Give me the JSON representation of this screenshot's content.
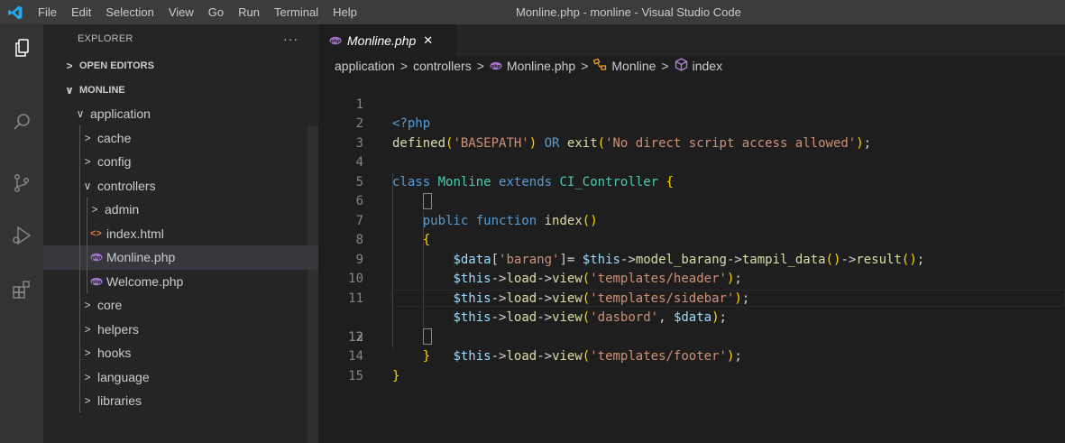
{
  "menubar": {
    "items": [
      "File",
      "Edit",
      "Selection",
      "View",
      "Go",
      "Run",
      "Terminal",
      "Help"
    ],
    "window_title": "Monline.php - monline - Visual Studio Code"
  },
  "activitybar": {
    "icons": [
      "explorer-icon",
      "search-icon",
      "source-control-icon",
      "run-debug-icon",
      "extensions-icon"
    ]
  },
  "sidebar": {
    "title": "EXPLORER",
    "more": "···",
    "open_editors": "OPEN EDITORS",
    "project": "MONLINE",
    "tree": [
      {
        "label": "application",
        "type": "folder",
        "open": true
      },
      {
        "label": "cache",
        "type": "folder",
        "open": false
      },
      {
        "label": "config",
        "type": "folder",
        "open": false
      },
      {
        "label": "controllers",
        "type": "folder",
        "open": true
      },
      {
        "label": "admin",
        "type": "folder",
        "open": false
      },
      {
        "label": "index.html",
        "type": "html"
      },
      {
        "label": "Monline.php",
        "type": "php",
        "selected": true
      },
      {
        "label": "Welcome.php",
        "type": "php"
      },
      {
        "label": "core",
        "type": "folder",
        "open": false
      },
      {
        "label": "helpers",
        "type": "folder",
        "open": false
      },
      {
        "label": "hooks",
        "type": "folder",
        "open": false
      },
      {
        "label": "language",
        "type": "folder",
        "open": false
      },
      {
        "label": "libraries",
        "type": "folder",
        "open": false
      }
    ]
  },
  "editor": {
    "tab": {
      "label": "Monline.php",
      "close": "✕"
    },
    "breadcrumb": [
      "application",
      "controllers",
      "Monline.php",
      "Monline",
      "index"
    ],
    "active_line": 12,
    "lines": [
      {
        "n": "1",
        "t": "<?php"
      },
      {
        "n": "2",
        "t": "defined('BASEPATH') OR exit('No direct script access allowed');"
      },
      {
        "n": "3",
        "t": ""
      },
      {
        "n": "4",
        "t": "class Monline extends CI_Controller {"
      },
      {
        "n": "5",
        "t": ""
      },
      {
        "n": "6",
        "t": "    public function index()"
      },
      {
        "n": "7",
        "t": "    {"
      },
      {
        "n": "8",
        "t": "        $data['barang']= $this->model_barang->tampil_data()->result();"
      },
      {
        "n": "9",
        "t": "        $this->load->view('templates/header');"
      },
      {
        "n": "10",
        "t": "        $this->load->view('templates/sidebar');"
      },
      {
        "n": "11",
        "t": "        $this->load->view('dasbord', $data);"
      },
      {
        "n": "12",
        "t": "        $this->load->view('templates/footer');"
      },
      {
        "n": "13",
        "t": "    }"
      },
      {
        "n": "14",
        "t": "}"
      },
      {
        "n": "15",
        "t": ""
      }
    ]
  }
}
